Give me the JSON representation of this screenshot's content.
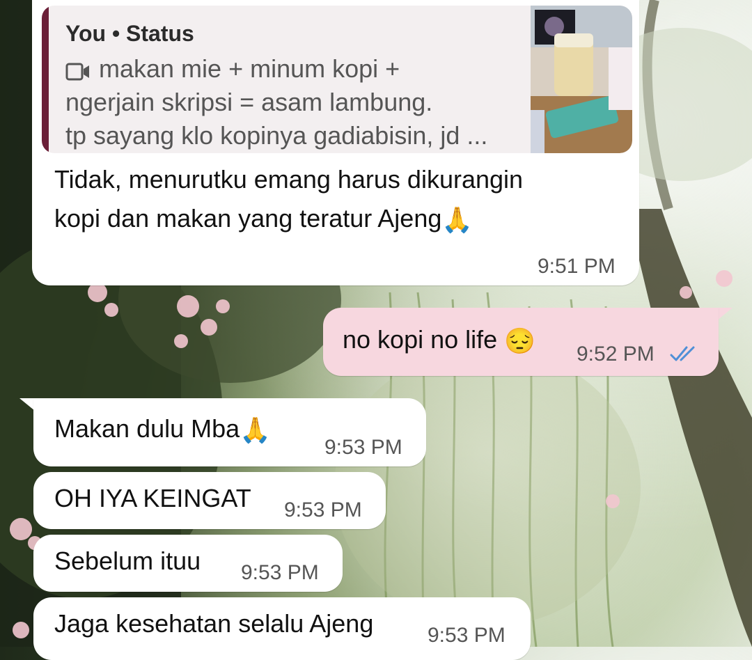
{
  "reply": {
    "quote": {
      "title": "You • Status",
      "lines": [
        "makan mie + minum kopi +",
        "ngerjain skripsi = asam lambung.",
        "tp sayang klo kopinya gadiabisin, jd ..."
      ],
      "icon": "video-camera-icon"
    },
    "text_line1": "Tidak, menurutku emang harus dikurangin",
    "text_line2": "kopi dan makan yang teratur Ajeng",
    "emoji": "🙏",
    "time": "9:51 PM"
  },
  "messages": [
    {
      "direction": "out",
      "text": "no kopi no life",
      "emoji": "😔",
      "time": "9:52 PM",
      "status": "read-double-check-icon"
    },
    {
      "direction": "in",
      "text": "Makan dulu Mba",
      "emoji": "🙏",
      "time": "9:53 PM"
    },
    {
      "direction": "in",
      "text": "OH IYA KEINGAT",
      "time": "9:53 PM"
    },
    {
      "direction": "in",
      "text": "Sebelum ituu",
      "time": "9:53 PM"
    },
    {
      "direction": "in",
      "text": "Jaga kesehatan selalu Ajeng",
      "time": "9:53 PM"
    }
  ],
  "colors": {
    "incoming_bubble": "#ffffff",
    "outgoing_bubble": "#f7d7df",
    "quote_bar": "#6b1f38",
    "read_ticks": "#4f8fd6"
  }
}
